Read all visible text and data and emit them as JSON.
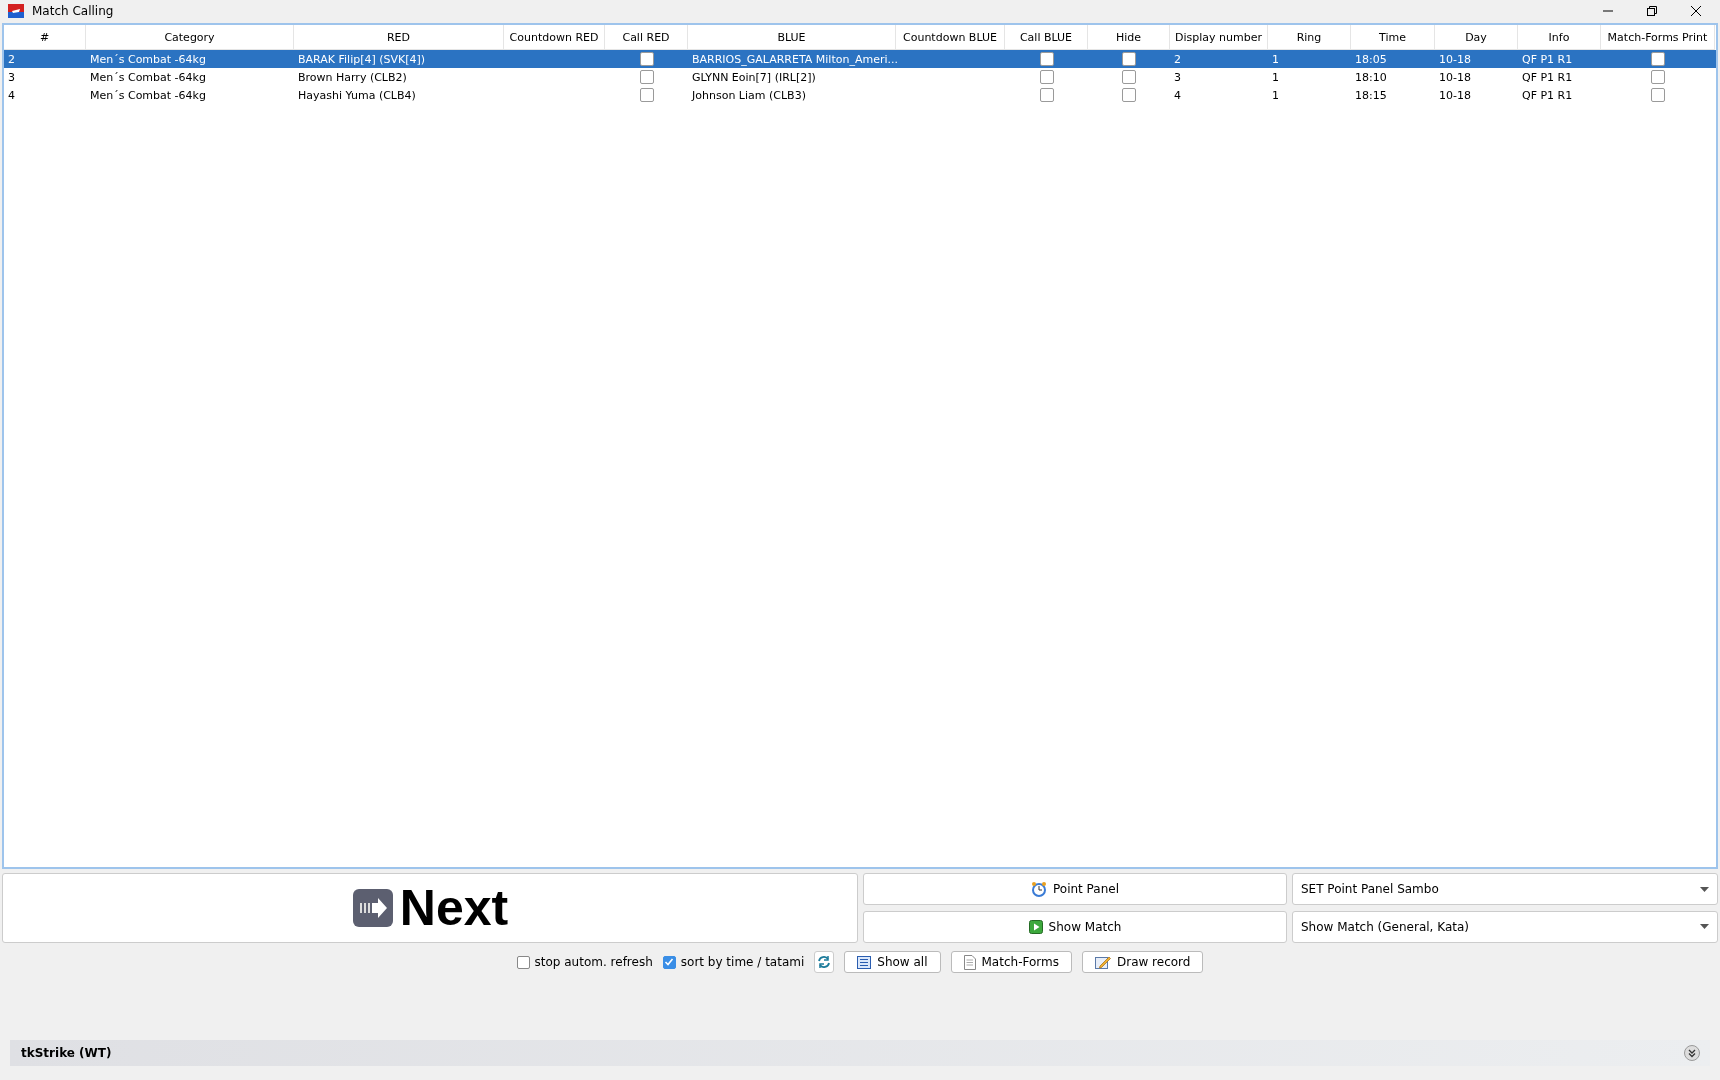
{
  "window": {
    "title": "Match Calling"
  },
  "table": {
    "columns": [
      "#",
      "Category",
      "RED",
      "Countdown RED",
      "Call RED",
      "BLUE",
      "Countdown BLUE",
      "Call BLUE",
      "Hide",
      "Display number",
      "Ring",
      "Time",
      "Day",
      "Info",
      "Match-Forms Print"
    ],
    "rows": [
      {
        "selected": true,
        "number": "2",
        "category": "Men´s Combat -64kg",
        "red": "BARAK Filip[4] (SVK[4])",
        "call_red": false,
        "blue": "BARRIOS_GALARRETA Milton_Ameri...",
        "call_blue": false,
        "hide": false,
        "display_number": "2",
        "ring": "1",
        "time": "18:05",
        "day": "10-18",
        "info": "QF P1 R1",
        "forms_print": false
      },
      {
        "selected": false,
        "number": "3",
        "category": "Men´s Combat -64kg",
        "red": "Brown Harry (CLB2)",
        "call_red": false,
        "blue": "GLYNN Eoin[7] (IRL[2])",
        "call_blue": false,
        "hide": false,
        "display_number": "3",
        "ring": "1",
        "time": "18:10",
        "day": "10-18",
        "info": "QF P1 R1",
        "forms_print": false
      },
      {
        "selected": false,
        "number": "4",
        "category": "Men´s Combat -64kg",
        "red": "Hayashi Yuma (CLB4)",
        "call_red": false,
        "blue": "Johnson Liam (CLB3)",
        "call_blue": false,
        "hide": false,
        "display_number": "4",
        "ring": "1",
        "time": "18:15",
        "day": "10-18",
        "info": "QF P1 R1",
        "forms_print": false
      }
    ]
  },
  "next_button": {
    "label": "Next"
  },
  "point_panel_button": {
    "label": "Point Panel"
  },
  "point_panel_select": {
    "value": "SET Point Panel Sambo"
  },
  "show_match_button": {
    "label": "Show Match"
  },
  "show_match_select": {
    "value": "Show Match (General, Kata)"
  },
  "toolbar": [
    {
      "kind": "checkbox",
      "label": "stop autom. refresh",
      "checked": false
    },
    {
      "kind": "checkbox",
      "label": "sort by time / tatami",
      "checked": true
    },
    {
      "kind": "refresh"
    },
    {
      "kind": "button",
      "label": "Show all"
    },
    {
      "kind": "button",
      "label": "Match-Forms"
    },
    {
      "kind": "button",
      "label": "Draw record"
    }
  ],
  "status_bar": {
    "title": "tkStrike (WT)"
  }
}
